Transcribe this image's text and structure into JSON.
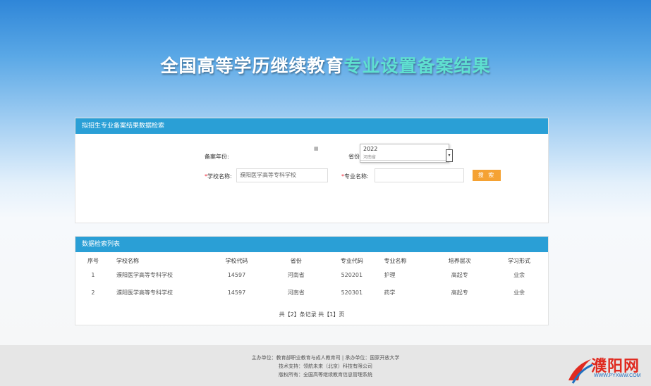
{
  "banner": {
    "title_part1": "全国高等学历继续教育",
    "title_part2": "专业设置备案结果"
  },
  "search": {
    "panel_title": "拟招生专业备案结果数据检索",
    "year_label": "备案年份:",
    "province_label": "省份",
    "year_value": "2022",
    "province_partial": "河南省",
    "school_label_req": "*",
    "school_label": "学校名称:",
    "school_value": "濮阳医学高等专科学校",
    "major_label_req": "*",
    "major_label": "专业名称:",
    "major_value": "",
    "search_button": "搜 索",
    "calendar_icon": "calendar-icon",
    "dropdown_icon": "chevron-down-icon"
  },
  "results": {
    "panel_title": "数据检索列表",
    "headers": [
      "序号",
      "学校名称",
      "学校代码",
      "省份",
      "专业代码",
      "专业名称",
      "培养层次",
      "学习形式"
    ],
    "rows": [
      [
        "1",
        "濮阳医学高等专科学校",
        "14597",
        "河南省",
        "520201",
        "护理",
        "高起专",
        "业余"
      ],
      [
        "2",
        "濮阳医学高等专科学校",
        "14597",
        "河南省",
        "520301",
        "药学",
        "高起专",
        "业余"
      ]
    ],
    "pager": "共【2】条记录 共【1】页"
  },
  "footer": {
    "line1": "主办单位：教育部职业教育与成人教育司 | 承办单位：国家开放大学",
    "line2": "技术支持：领航未来（北京）科技有限公司",
    "line3": "版权所有：全国高等继续教育信息管理系统"
  },
  "watermark": {
    "name": "濮阳网",
    "url": "WWW.PYXWW.COM"
  }
}
